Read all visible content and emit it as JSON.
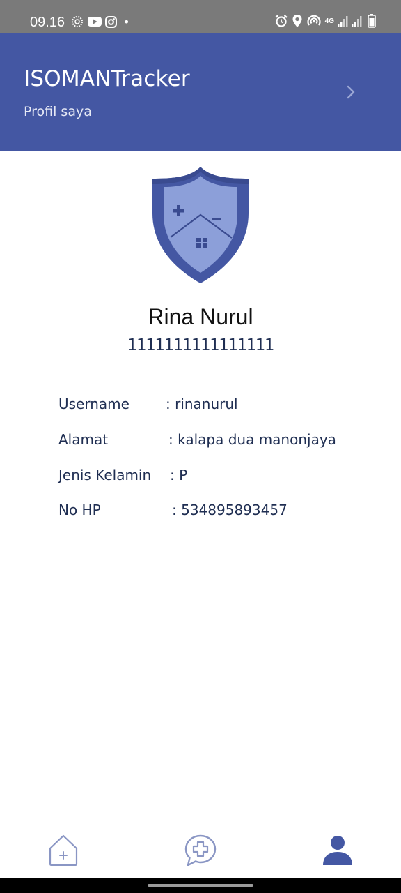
{
  "status_bar": {
    "time": "09.16",
    "network_label": "4G",
    "dot": "•",
    "icons": [
      "wheel-icon",
      "youtube-icon",
      "instagram-icon",
      "alarm-icon",
      "location-icon",
      "hotspot-icon",
      "signal-icon",
      "battery-icon"
    ]
  },
  "header": {
    "title": "ISOMANTracker",
    "subtitle": "Profil saya",
    "background": "#4457a3",
    "chevron": "chevron-right-icon"
  },
  "profile": {
    "name": "Rina Nurul",
    "id_number": "1111111111111111"
  },
  "info": {
    "username_label": "Username",
    "username_value": ": rinanurul",
    "alamat_label": "Alamat",
    "alamat_value": ": kalapa dua manonjaya",
    "jenis_kelamin_label": "Jenis Kelamin",
    "jenis_kelamin_value": ": P",
    "no_hp_label": "No HP",
    "no_hp_value": ": 534895893457"
  },
  "bottom_nav": {
    "items": [
      {
        "name": "home",
        "icon": "home-plus-icon",
        "active": false
      },
      {
        "name": "consult",
        "icon": "chat-plus-icon",
        "active": false
      },
      {
        "name": "profile",
        "icon": "person-icon",
        "active": true
      }
    ],
    "active_color": "#4457a3",
    "inactive_color": "#8a96c4"
  }
}
